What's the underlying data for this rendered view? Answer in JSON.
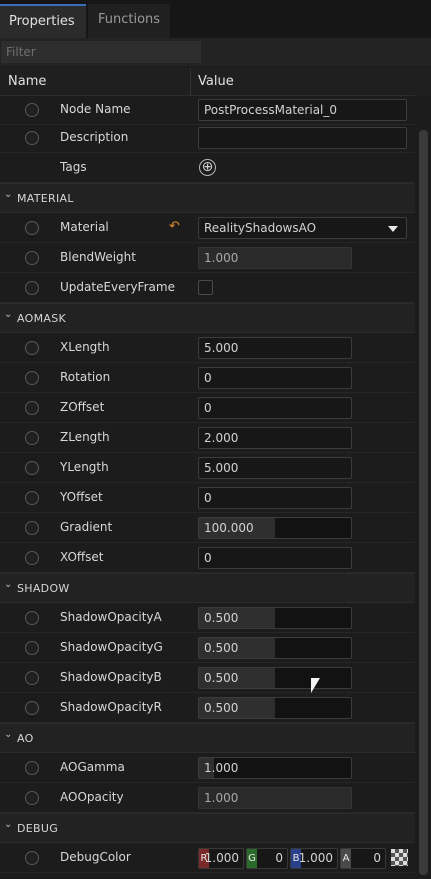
{
  "tabs": {
    "properties": "Properties",
    "functions": "Functions"
  },
  "filter": {
    "placeholder": "Filter",
    "value": ""
  },
  "columns": {
    "name": "Name",
    "value": "Value"
  },
  "general": {
    "node_name_label": "Node Name",
    "node_name_value": "PostProcessMaterial_0",
    "description_label": "Description",
    "description_value": "",
    "tags_label": "Tags"
  },
  "material_section": {
    "title": "MATERIAL",
    "material_label": "Material",
    "material_value": "RealityShadowsAO",
    "blendweight_label": "BlendWeight",
    "blendweight_value": "1.000",
    "update_label": "UpdateEveryFrame",
    "update_checked": false
  },
  "aomask_section": {
    "title": "AOMASK",
    "xlength_label": "XLength",
    "xlength_value": "5.000",
    "rotation_label": "Rotation",
    "rotation_value": "0",
    "zoffset_label": "ZOffset",
    "zoffset_value": "0",
    "zlength_label": "ZLength",
    "zlength_value": "2.000",
    "ylength_label": "YLength",
    "ylength_value": "5.000",
    "yoffset_label": "YOffset",
    "yoffset_value": "0",
    "gradient_label": "Gradient",
    "gradient_value": "100.000",
    "gradient_fill": 0.5,
    "xoffset_label": "XOffset",
    "xoffset_value": "0"
  },
  "shadow_section": {
    "title": "SHADOW",
    "a_label": "ShadowOpacityA",
    "a_value": "0.500",
    "a_fill": 0.5,
    "g_label": "ShadowOpacityG",
    "g_value": "0.500",
    "g_fill": 0.5,
    "b_label": "ShadowOpacityB",
    "b_value": "0.500",
    "b_fill": 0.5,
    "r_label": "ShadowOpacityR",
    "r_value": "0.500",
    "r_fill": 0.5
  },
  "ao_section": {
    "title": "AO",
    "gamma_label": "AOGamma",
    "gamma_value": "1.000",
    "gamma_fill": 0.1,
    "opacity_label": "AOOpacity",
    "opacity_value": "1.000"
  },
  "debug_section": {
    "title": "DEBUG",
    "color_label": "DebugColor",
    "r_tag": "R",
    "r_value": "1.000",
    "g_tag": "G",
    "g_value": "0",
    "b_tag": "B",
    "b_value": "1.000",
    "a_tag": "A",
    "a_value": "0"
  },
  "colors": {
    "accent": "#3a6fb8",
    "reset": "#e0902a",
    "channel_r": "#7a2a2a",
    "channel_g": "#2a6a2a",
    "channel_b": "#2a3f8a",
    "channel_a": "#4a4a4a"
  },
  "icons": {
    "add": "⊕",
    "reset": "↶",
    "section_chevron": "⌄"
  }
}
